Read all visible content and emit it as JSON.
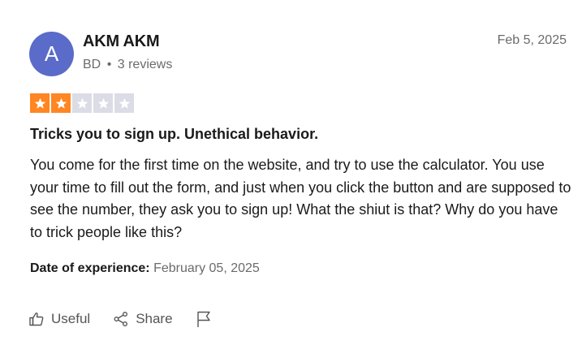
{
  "reviewer": {
    "initial": "A",
    "name": "AKM AKM",
    "country": "BD",
    "separator": "•",
    "review_count": "3 reviews"
  },
  "review": {
    "date": "Feb 5, 2025",
    "rating": 2,
    "max_rating": 5,
    "title": "Tricks you to sign up. Unethical behavior.",
    "body": "You come for the first time on the website, and try to use the calculator. You use your time to fill out the form, and just when you click the button and are supposed to see the number, they ask you to sign up! What the shiut is that? Why do you have to trick people like this?",
    "experience_label": "Date of experience:",
    "experience_date": "February 05, 2025"
  },
  "actions": {
    "useful_label": "Useful",
    "share_label": "Share"
  },
  "icons": {
    "useful": "thumbs-up-icon",
    "share": "share-icon",
    "flag": "flag-icon",
    "star": "star-icon"
  },
  "colors": {
    "avatar_bg": "#5b6bc9",
    "star_filled": "#ff8622",
    "star_empty": "#dcdce6",
    "text_primary": "#1a1a1a",
    "text_secondary": "#6b6b6b"
  }
}
